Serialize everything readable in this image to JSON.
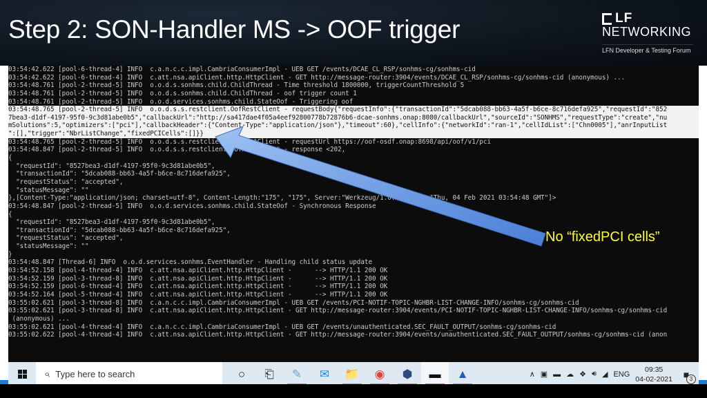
{
  "slide": {
    "title": "Step 2: SON-Handler MS -> OOF trigger",
    "logo_lf": "LF",
    "logo_networking": "NETWORKING",
    "logo_subtitle": "LFN Developer & Testing Forum",
    "callout": "No “fixedPCI cells”",
    "callout_color": "#ffff33",
    "arrow_color": "#5b8fe0"
  },
  "console": {
    "lines": [
      {
        "text": "03:54:42.622 [pool-6-thread-4] INFO  c.a.n.c.c.impl.CambriaConsumerImpl - UEB GET /events/DCAE_CL_RSP/sonhms-cg/sonhms-cid",
        "highlight": false
      },
      {
        "text": "03:54:42.622 [pool-6-thread-4] INFO  c.att.nsa.apiClient.http.HttpClient - GET http://message-router:3904/events/DCAE_CL_RSP/sonhms-cg/sonhms-cid (anonymous) ...",
        "highlight": false
      },
      {
        "text": "03:54:48.761 [pool-2-thread-5] INFO  o.o.d.s.sonhms.child.ChildThread - Time threshold 1800000, triggerCountThreshold 5",
        "highlight": false
      },
      {
        "text": "03:54:48.761 [pool-2-thread-5] INFO  o.o.d.s.sonhms.child.ChildThread - oof trigger count 1",
        "highlight": false
      },
      {
        "text": "03:54:48.761 [pool-2-thread-5] INFO  o.o.d.services.sonhms.child.StateOof - Triggering oof",
        "highlight": false
      },
      {
        "text": "03:54:48.765 [pool-2-thread-5] INFO  o.o.d.s.s.restclient.OofRestClient - requestBody{\"requestInfo\":{\"transactionId\":\"5dcab088-bb63-4a5f-b6ce-8c716defa925\",\"requestId\":\"852",
        "highlight": true
      },
      {
        "text": "7bea3-d1df-4197-95f0-9c3d81abe0b5\",\"callbackUrl\":\"http://sa417dae4f05a4eef92800778b72876b6-dcae-sonhms.onap:8080/callbackUrl\",\"sourceId\":\"SONHMS\",\"requestType\":\"create\",\"nu",
        "highlight": true
      },
      {
        "text": "mSolutions\":5,\"optimizers\":[\"pci\"],\"callbackHeader\":{\"Content-Type\":\"application/json\"},\"timeout\":60},\"cellInfo\":{\"networkId\":\"ran-1\",\"cellIdList\":[\"Chn0005\"],\"anrInputList",
        "highlight": true
      },
      {
        "text": "\":[],\"trigger\":\"NbrListChange\",\"fixedPCICells\":[]}}",
        "highlight": true
      },
      {
        "text": "03:54:48.765 [pool-2-thread-5] INFO  o.o.d.s.s.restclient.OofRestClient - requestUrl https://oof-osdf.onap:8698/api/oof/v1/pci",
        "highlight": false
      },
      {
        "text": "03:54:48.847 [pool-2-thread-5] INFO  o.o.d.s.s.restclient.OofRestClient - response <202,",
        "highlight": false
      },
      {
        "text": "{",
        "highlight": false
      },
      {
        "text": "  \"requestId\": \"8527bea3-d1df-4197-95f0-9c3d81abe0b5\",",
        "highlight": false
      },
      {
        "text": "  \"transactionId\": \"5dcab088-bb63-4a5f-b6ce-8c716defa925\",",
        "highlight": false
      },
      {
        "text": "  \"requestStatus\": \"accepted\",",
        "highlight": false
      },
      {
        "text": "  \"statusMessage\": \"\"",
        "highlight": false
      },
      {
        "text": "},[Content-Type:\"application/json; charset=utf-8\", Content-Length:\"175\", \"175\", Server:\"Werkzeug/1.0.1\", Date:\"Thu, 04 Feb 2021 03:54:48 GMT\"]>",
        "highlight": false
      },
      {
        "text": "03:54:48.847 [pool-2-thread-5] INFO  o.o.d.services.sonhms.child.StateOof - Synchronous Response",
        "highlight": false
      },
      {
        "text": "{",
        "highlight": false
      },
      {
        "text": "  \"requestId\": \"8527bea3-d1df-4197-95f0-9c3d81abe0b5\",",
        "highlight": false
      },
      {
        "text": "  \"transactionId\": \"5dcab088-bb63-4a5f-b6ce-8c716defa925\",",
        "highlight": false
      },
      {
        "text": "  \"requestStatus\": \"accepted\",",
        "highlight": false
      },
      {
        "text": "  \"statusMessage\": \"\"",
        "highlight": false
      },
      {
        "text": "}",
        "highlight": false
      },
      {
        "text": "03:54:48.847 [Thread-6] INFO  o.o.d.services.sonhms.EventHandler - Handling child status update",
        "highlight": false
      },
      {
        "text": "03:54:52.158 [pool-4-thread-4] INFO  c.att.nsa.apiClient.http.HttpClient -      --> HTTP/1.1 200 OK",
        "highlight": false
      },
      {
        "text": "03:54:52.159 [pool-3-thread-8] INFO  c.att.nsa.apiClient.http.HttpClient -      --> HTTP/1.1 200 OK",
        "highlight": false
      },
      {
        "text": "03:54:52.159 [pool-6-thread-4] INFO  c.att.nsa.apiClient.http.HttpClient -      --> HTTP/1.1 200 OK",
        "highlight": false
      },
      {
        "text": "03:54:52.164 [pool-5-thread-4] INFO  c.att.nsa.apiClient.http.HttpClient -      --> HTTP/1.1 200 OK",
        "highlight": false
      },
      {
        "text": "03:55:02.621 [pool-3-thread-8] INFO  c.a.n.c.c.impl.CambriaConsumerImpl - UEB GET /events/PCI-NOTIF-TOPIC-NGHBR-LIST-CHANGE-INFO/sonhms-cg/sonhms-cid",
        "highlight": false
      },
      {
        "text": "03:55:02.621 [pool-3-thread-8] INFO  c.att.nsa.apiClient.http.HttpClient - GET http://message-router:3904/events/PCI-NOTIF-TOPIC-NGHBR-LIST-CHANGE-INFO/sonhms-cg/sonhms-cid",
        "highlight": false
      },
      {
        "text": " (anonymous) ...",
        "highlight": false
      },
      {
        "text": "03:55:02.621 [pool-4-thread-4] INFO  c.a.n.c.c.impl.CambriaConsumerImpl - UEB GET /events/unauthenticated.SEC_FAULT_OUTPUT/sonhms-cg/sonhms-cid",
        "highlight": false
      },
      {
        "text": "03:55:02.622 [pool-4-thread-4] INFO  c.att.nsa.apiClient.http.HttpClient - GET http://message-router:3904/events/unauthenticated.SEC_FAULT_OUTPUT/sonhms-cg/sonhms-cid (anon",
        "highlight": false
      }
    ]
  },
  "taskbar": {
    "start_icon": "windows-logo-icon",
    "search_placeholder": "Type here to search",
    "icons": [
      {
        "name": "cortana-icon",
        "glyph": "○",
        "active": false
      },
      {
        "name": "task-view-icon",
        "glyph": "⎗",
        "active": false
      },
      {
        "name": "notepad-icon",
        "glyph": "✎",
        "active": true
      },
      {
        "name": "mail-icon",
        "glyph": "✉",
        "active": false
      },
      {
        "name": "file-explorer-icon",
        "glyph": "📁",
        "active": true
      },
      {
        "name": "chrome-icon",
        "glyph": "◉",
        "active": true
      },
      {
        "name": "virtualbox-icon",
        "glyph": "⬢",
        "active": true
      },
      {
        "name": "command-prompt-icon",
        "glyph": "▬",
        "active": true
      },
      {
        "name": "photos-icon",
        "glyph": "▲",
        "active": true
      }
    ],
    "tray": {
      "chevron": "∧",
      "language": "ENG",
      "time": "09:35",
      "date": "04-02-2021",
      "notification_count": "3"
    }
  }
}
